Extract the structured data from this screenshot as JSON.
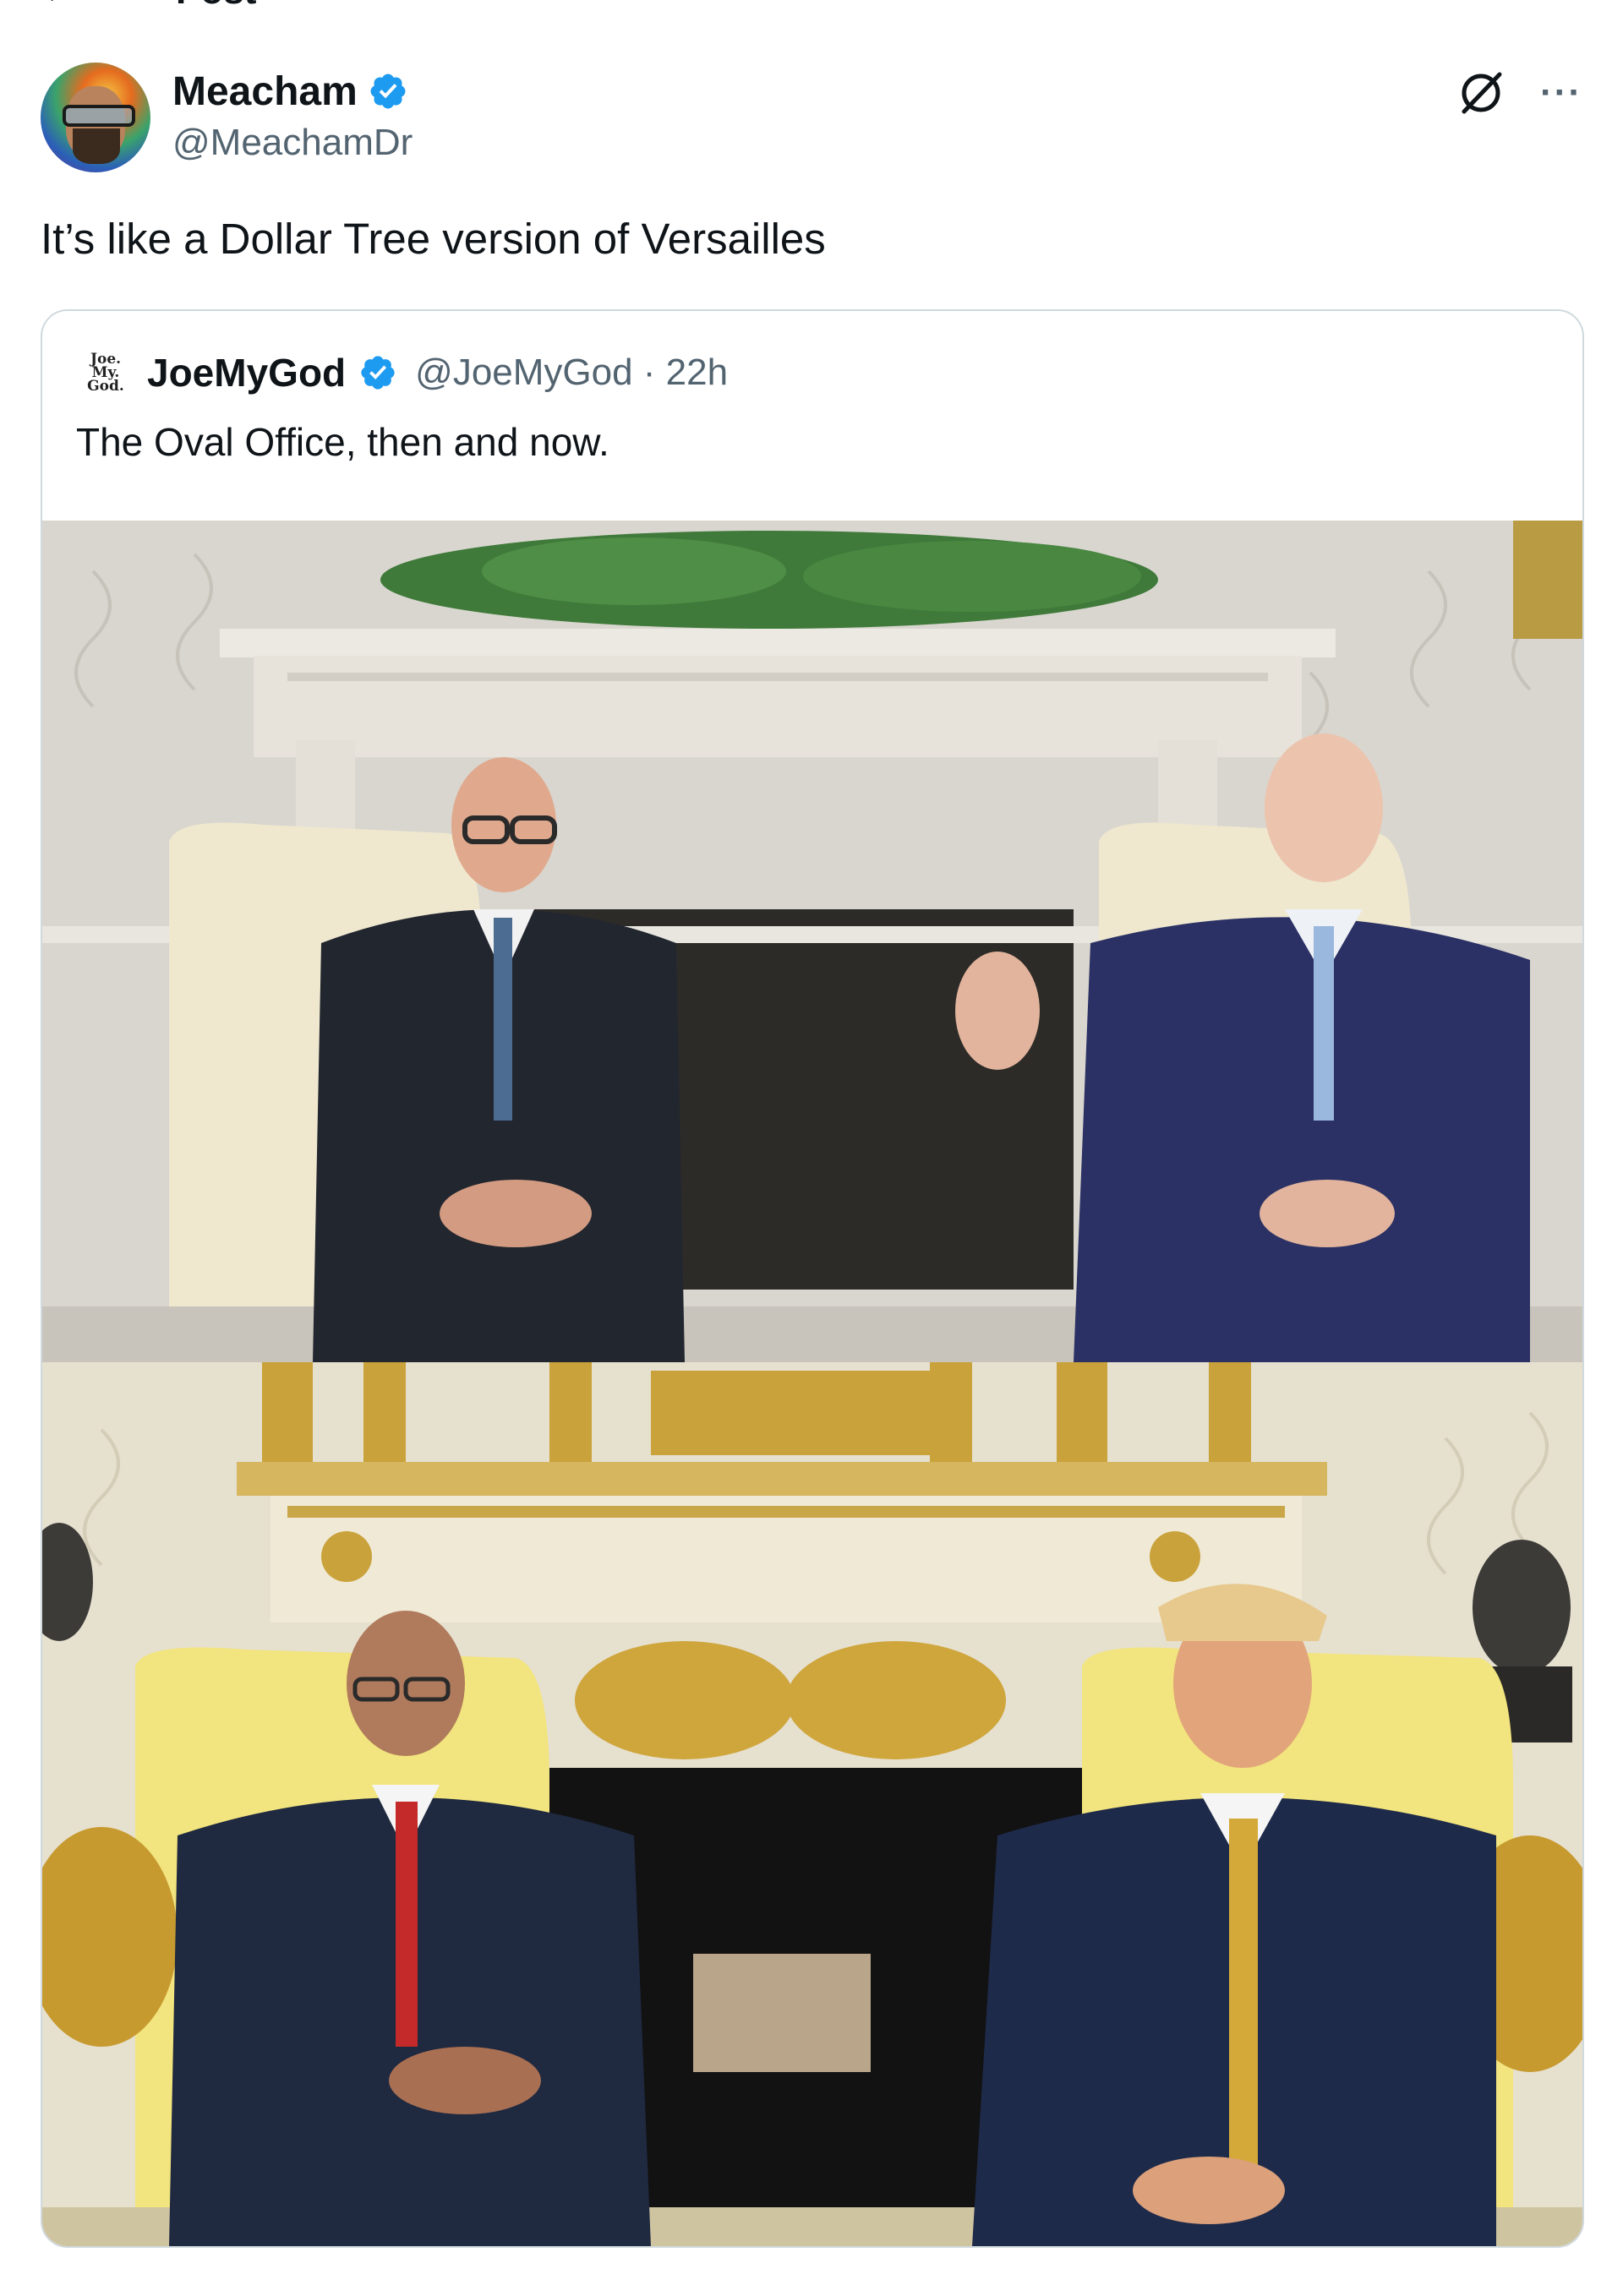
{
  "header": {
    "back_icon": "back-arrow-icon",
    "title": "Post"
  },
  "post": {
    "author": {
      "display_name": "Meacham",
      "handle": "@MeachamDr",
      "verified": true,
      "verified_color": "#1d9bf0"
    },
    "text": "It’s like a Dollar Tree version of Versailles",
    "actions": {
      "grok_icon": "grok-icon",
      "more_label": "···"
    },
    "quoted": {
      "avatar_text": [
        "Joe.",
        "My.",
        "God."
      ],
      "display_name": "JoeMyGod",
      "verified": true,
      "handle_time": "@JoeMyGod · 22h",
      "text": "The Oval Office, then and now.",
      "images": [
        {
          "name": "oval-office-then-photo"
        },
        {
          "name": "oval-office-now-photo"
        }
      ]
    }
  },
  "colors": {
    "text_primary": "#0f1419",
    "text_secondary": "#536471",
    "border": "#cfd9de",
    "accent": "#1d9bf0"
  }
}
